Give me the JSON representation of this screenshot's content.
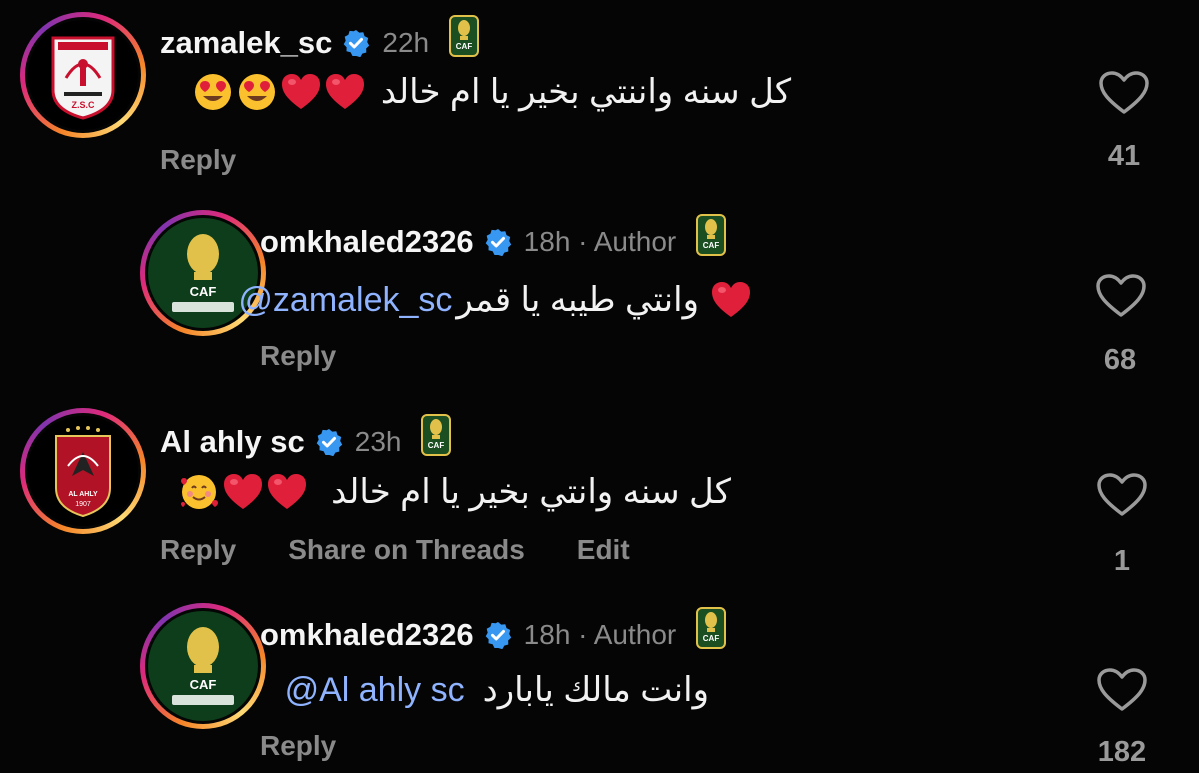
{
  "comments": [
    {
      "username": "zamalek_sc",
      "time": "22h",
      "text": "كل سنه واننتي بخير يا ام خالد",
      "emojis": [
        "red-heart",
        "red-heart",
        "heart-eyes",
        "heart-eyes"
      ],
      "actions": [
        "Reply"
      ],
      "likes": "41"
    },
    {
      "username": "omkhaled2326",
      "time": "18h · Author",
      "mention": "@zamalek_sc",
      "text": "وانتي طيبه يا قمر",
      "emojis": [
        "red-heart"
      ],
      "actions": [
        "Reply"
      ],
      "likes": "68"
    },
    {
      "username": "Al ahly sc",
      "time": "23h",
      "text": "كل سنه وانتي بخير يا ام خالد",
      "emojis": [
        "red-heart",
        "red-heart",
        "smiling-face-with-hearts"
      ],
      "actions": [
        "Reply",
        "Share on Threads",
        "Edit"
      ],
      "likes": "1"
    },
    {
      "username": "omkhaled2326",
      "time": "18h · Author",
      "mention": "@Al ahly sc",
      "text": "وانت مالك يابارد",
      "emojis": [],
      "actions": [
        "Reply"
      ],
      "likes": "182"
    }
  ],
  "avatars": {
    "zamalek": {
      "text": "Z.S.C"
    },
    "caf": {
      "text": "CAF"
    },
    "ahly": {
      "text": "AL AHLY",
      "year": "1907"
    }
  },
  "colors": {
    "background": "#050505",
    "verified": "#3897f0",
    "mention": "#8fb3ff",
    "muted": "#8a8a8a",
    "heart_red": "#e0203a"
  },
  "icons": {
    "verified": "verified-badge-icon",
    "like": "heart-outline-icon",
    "badge": "caf-badge-icon"
  }
}
